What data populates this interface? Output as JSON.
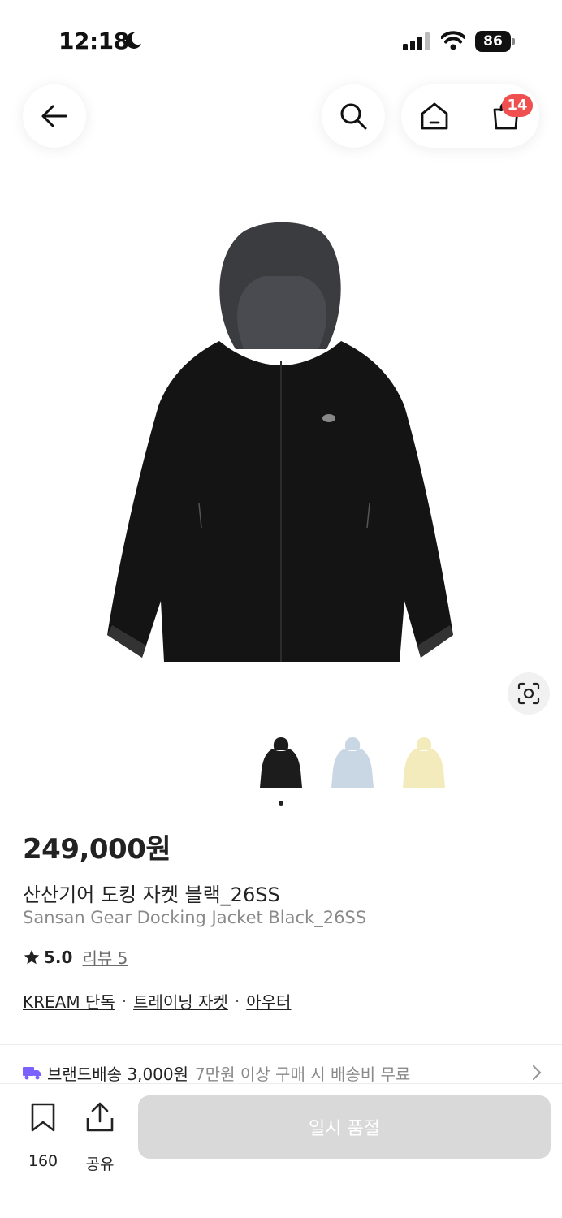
{
  "status_bar": {
    "time": "12:18",
    "battery": "86"
  },
  "header": {
    "cart_count": "14"
  },
  "product": {
    "price": "249,000원",
    "name_ko": "산산기어 도킹 자켓 블랙_26SS",
    "name_en": "Sansan Gear Docking Jacket Black_26SS",
    "rating": "5.0",
    "review_label": "리뷰 5",
    "tags": [
      "KREAM 단독",
      "트레이닝 자켓",
      "아우터"
    ],
    "tag_separator": "·",
    "thumbnails": [
      {
        "color": "#1c1c1c"
      },
      {
        "color": "#c9d6e4"
      },
      {
        "color": "#f3ebbb"
      }
    ]
  },
  "shipping": {
    "label": "브랜드배송 3,000원",
    "note": "7만원 이상 구매 시 배송비 무료"
  },
  "bottom": {
    "bookmark_count": "160",
    "share_label": "공유",
    "cta_label": "일시 품절"
  },
  "colors": {
    "badge": "#ef4f4f",
    "shipping_icon": "#7b61ff",
    "cta_disabled": "#d9d9d9"
  }
}
